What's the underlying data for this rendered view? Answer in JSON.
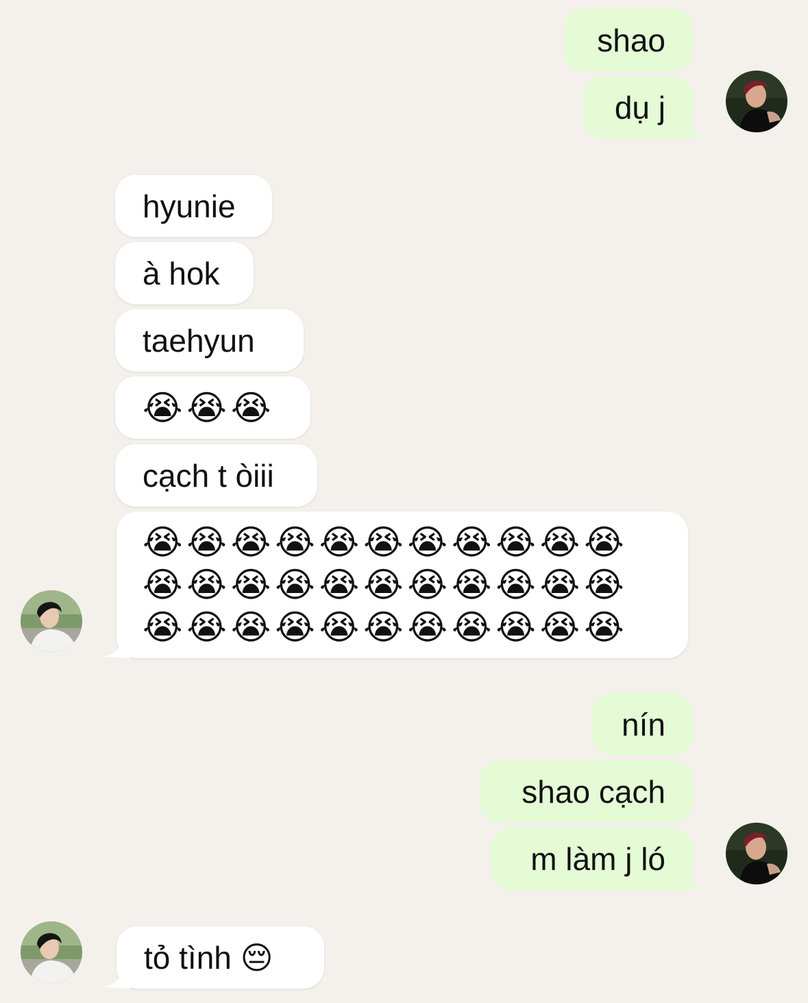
{
  "conversation": {
    "messages": [
      {
        "sender": "me",
        "text": "shao"
      },
      {
        "sender": "me",
        "text": "dụ j"
      },
      {
        "sender": "other",
        "text": "hyunie"
      },
      {
        "sender": "other",
        "text": "à hok"
      },
      {
        "sender": "other",
        "text": "taehyun"
      },
      {
        "sender": "other",
        "text": "😭😭😭"
      },
      {
        "sender": "other",
        "text": "cạch t òiii"
      },
      {
        "sender": "other",
        "rows": [
          "😭😭😭😭😭😭😭😭😭😭😭",
          "😭😭😭😭😭😭😭😭😭😭😭",
          "😭😭😭😭😭😭😭😭😭😭😭"
        ]
      },
      {
        "sender": "me",
        "text": "nín"
      },
      {
        "sender": "me",
        "text": "shao cạch"
      },
      {
        "sender": "me",
        "text": "m làm j ló"
      },
      {
        "sender": "other",
        "text": "tỏ tình 😔"
      }
    ]
  },
  "avatars": {
    "me": "avatar-red-hair",
    "other": "avatar-dark-hair"
  },
  "colors": {
    "background": "#f4f1ec",
    "outgoing_bubble": "#e4fbd6",
    "incoming_bubble": "#ffffff",
    "text": "#111111"
  }
}
